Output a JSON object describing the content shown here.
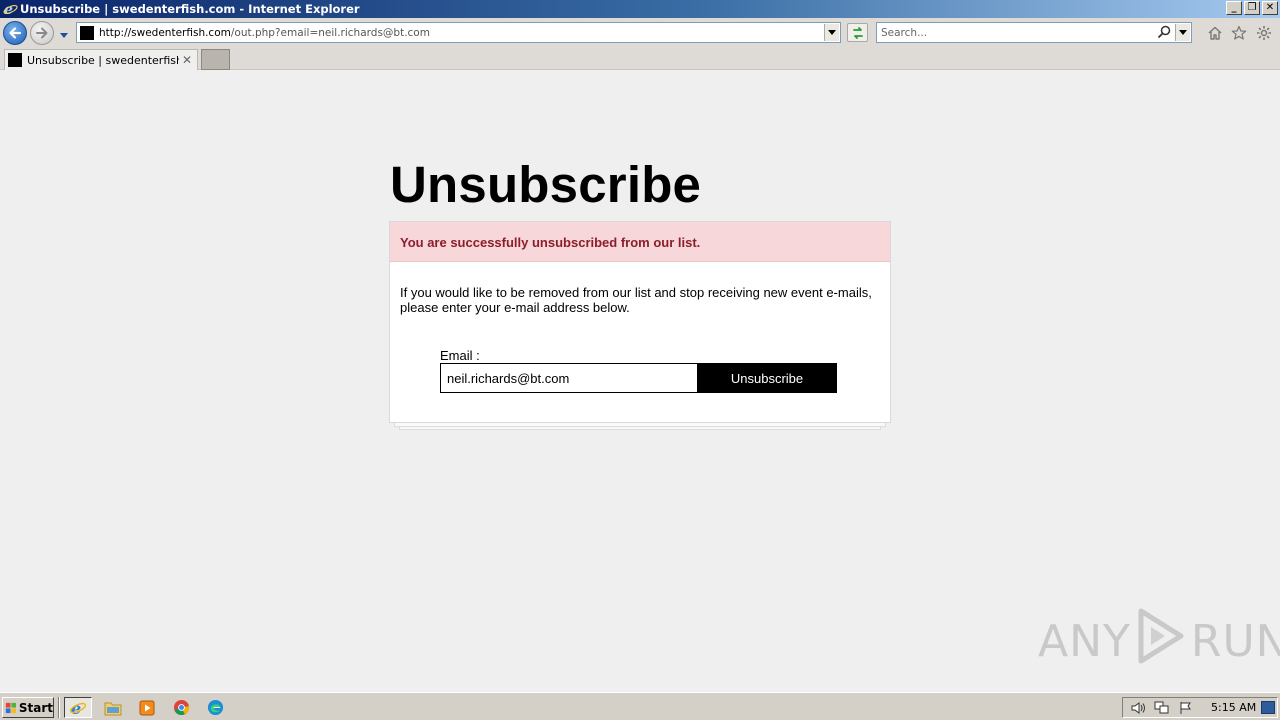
{
  "window": {
    "title": "Unsubscribe | swedenterfish.com - Internet Explorer",
    "minimize": "_",
    "restore": "❐",
    "close": "✕"
  },
  "addressbar": {
    "url_host": "http://swedenterfish.com",
    "url_path": "/out.php?email=neil.richards@bt.com",
    "search_placeholder": "Search..."
  },
  "tab": {
    "title": "Unsubscribe | swedenterfish....",
    "close": "✕"
  },
  "page": {
    "heading": "Unsubscribe",
    "alert": "You are successfully unsubscribed from our list.",
    "description": "If you would like to be removed from our list and stop receiving new event e-mails, please enter your e-mail address below.",
    "email_label": "Email :",
    "email_value": "neil.richards@bt.com",
    "button_label": "Unsubscribe"
  },
  "watermark": {
    "left": "ANY",
    "right": "RUN"
  },
  "taskbar": {
    "start_label": "Start",
    "apps": [
      "ie-icon",
      "folder-icon",
      "media-player-icon",
      "chrome-icon",
      "edge-icon"
    ],
    "clock": "5:15 AM"
  },
  "colors": {
    "alert_bg": "#f8d7da",
    "alert_text": "#8a1f2b",
    "button_bg": "#000000",
    "titlebar_start": "#0a246a"
  }
}
